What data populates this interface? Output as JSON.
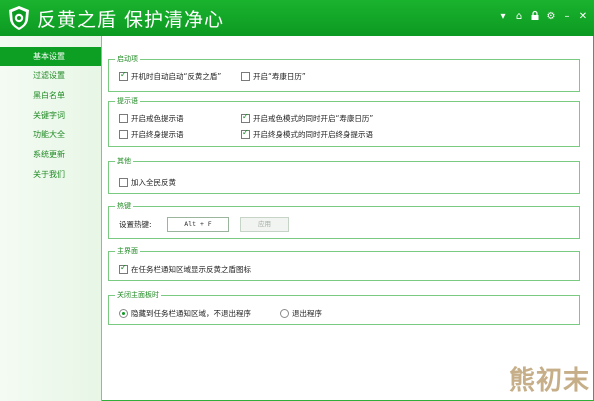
{
  "app": {
    "title": "反黄之盾  保护清净心"
  },
  "window_controls": [
    "▾",
    "⌂",
    "🔒",
    "⚙",
    "–",
    "✕"
  ],
  "sidebar": {
    "items": [
      {
        "label": "基本设置",
        "active": true
      },
      {
        "label": "过滤设置"
      },
      {
        "label": "黑白名单"
      },
      {
        "label": "关键字词"
      },
      {
        "label": "功能大全"
      },
      {
        "label": "系统更新"
      },
      {
        "label": "关于我们"
      }
    ]
  },
  "sections": {
    "startup": {
      "title": "启动项",
      "opt_autostart": "开机时自动启动“反黄之盾”",
      "opt_calendar": "开启“寿康日历”"
    },
    "tips": {
      "title": "提示语",
      "opt_precept_tip": "开启戒色提示语",
      "opt_precept_calendar": "开启戒色模式的同时开启“寿康日历”",
      "opt_lifelong_tip": "开启终身提示语",
      "opt_lifelong_mode": "开启终身模式的同时开启终身提示语"
    },
    "other": {
      "title": "其他",
      "opt_join": "加入全民反黄"
    },
    "hotkey": {
      "title": "热键",
      "label": "设置热键:",
      "value": "Alt + F",
      "apply": "应用"
    },
    "main_ui": {
      "title": "主界面",
      "opt_tray_icon": "在任务栏通知区域显示反黄之盾图标"
    },
    "close_main": {
      "title": "关闭主面板时",
      "opt_hide": "隐藏到任务栏通知区域，不退出程序",
      "opt_exit": "退出程序"
    }
  },
  "watermark": "熊初末",
  "colors": {
    "accent": "#0c9a22",
    "text_green": "#1e8a22"
  }
}
